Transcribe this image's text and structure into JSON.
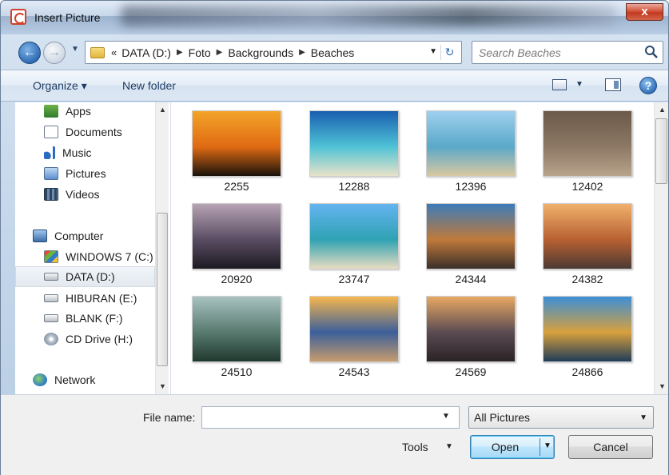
{
  "window": {
    "title": "Insert Picture",
    "close_label": "x"
  },
  "address": {
    "overflow": "«",
    "crumbs": [
      "DATA (D:)",
      "Foto",
      "Backgrounds",
      "Beaches"
    ]
  },
  "search": {
    "placeholder": "Search Beaches"
  },
  "toolbar": {
    "organize": "Organize ▾",
    "new_folder": "New folder",
    "help": "?"
  },
  "nav": {
    "items": [
      {
        "label": "Apps",
        "icon": "apps-icon"
      },
      {
        "label": "Documents",
        "icon": "documents-icon"
      },
      {
        "label": "Music",
        "icon": "music-icon"
      },
      {
        "label": "Pictures",
        "icon": "pictures-icon"
      },
      {
        "label": "Videos",
        "icon": "videos-icon"
      },
      {
        "label": "Computer",
        "icon": "computer-icon"
      },
      {
        "label": "WINDOWS 7 (C:)",
        "icon": "windows-drive-icon"
      },
      {
        "label": "DATA (D:)",
        "icon": "drive-icon",
        "selected": true
      },
      {
        "label": "HIBURAN (E:)",
        "icon": "drive-icon"
      },
      {
        "label": "BLANK (F:)",
        "icon": "drive-icon"
      },
      {
        "label": "CD Drive (H:)",
        "icon": "cd-drive-icon"
      },
      {
        "label": "Network",
        "icon": "network-icon"
      }
    ]
  },
  "files": [
    {
      "name": "2255",
      "colors": [
        "#f3a42a",
        "#e06a12",
        "#1a120b"
      ]
    },
    {
      "name": "12288",
      "colors": [
        "#1a5fb0",
        "#4fc3d6",
        "#e7e2c8"
      ]
    },
    {
      "name": "12396",
      "colors": [
        "#9fd0ef",
        "#5aa8c9",
        "#d8c8a0"
      ]
    },
    {
      "name": "12402",
      "colors": [
        "#6b5a4a",
        "#8c7864",
        "#b8a48c"
      ]
    },
    {
      "name": "20920",
      "colors": [
        "#b6a3b4",
        "#5a4d63",
        "#1d1a22"
      ]
    },
    {
      "name": "23747",
      "colors": [
        "#63b4f0",
        "#2fa2b3",
        "#e8dcc0"
      ]
    },
    {
      "name": "24344",
      "colors": [
        "#3d7bb8",
        "#c07a3a",
        "#3a2f2a"
      ]
    },
    {
      "name": "24382",
      "colors": [
        "#f0b16c",
        "#b86132",
        "#4c3a33"
      ]
    },
    {
      "name": "24510",
      "colors": [
        "#a8c2c0",
        "#587a6f",
        "#20392f"
      ]
    },
    {
      "name": "24543",
      "colors": [
        "#f6b74e",
        "#3b5f9a",
        "#c79c6d"
      ]
    },
    {
      "name": "24569",
      "colors": [
        "#e8a864",
        "#5b4b52",
        "#2a2326"
      ]
    },
    {
      "name": "24866",
      "colors": [
        "#3c8fd6",
        "#d8a03d",
        "#1f3c59"
      ]
    }
  ],
  "bottom": {
    "file_name_label": "File name:",
    "file_name_value": "",
    "filter": "All Pictures",
    "tools": "Tools",
    "open": "Open",
    "cancel": "Cancel"
  },
  "colors": {
    "accent": "#3c7fb1",
    "selection": "#e3e9ef"
  }
}
